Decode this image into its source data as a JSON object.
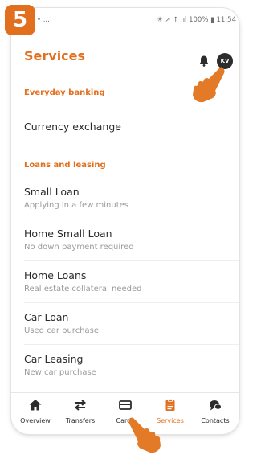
{
  "step": "5",
  "statusbar": {
    "left": "• ...",
    "right": "✳ ↗ ↑ .ıl 100% ▮ 11:54"
  },
  "header": {
    "title": "Services",
    "avatar_initials": "KV"
  },
  "sections": [
    {
      "label": "Everyday banking"
    },
    {
      "label": "Loans and leasing"
    }
  ],
  "items": [
    {
      "title": "Currency exchange",
      "subtitle": ""
    },
    {
      "title": "Small Loan",
      "subtitle": "Applying in a few minutes"
    },
    {
      "title": "Home Small Loan",
      "subtitle": "No down payment required"
    },
    {
      "title": "Home Loans",
      "subtitle": "Real estate collateral needed"
    },
    {
      "title": "Car Loan",
      "subtitle": "Used car purchase"
    },
    {
      "title": "Car Leasing",
      "subtitle": "New car purchase"
    }
  ],
  "tabs": [
    {
      "label": "Overview",
      "icon": "home-icon",
      "active": false
    },
    {
      "label": "Transfers",
      "icon": "transfer-arrows-icon",
      "active": false
    },
    {
      "label": "Cards",
      "icon": "card-icon",
      "active": false
    },
    {
      "label": "Services",
      "icon": "services-icon",
      "active": true
    },
    {
      "label": "Contacts",
      "icon": "chat-icon",
      "active": false
    }
  ],
  "colors": {
    "accent": "#e26f1e",
    "text": "#2b2b2b",
    "muted": "#9a9a9a"
  }
}
